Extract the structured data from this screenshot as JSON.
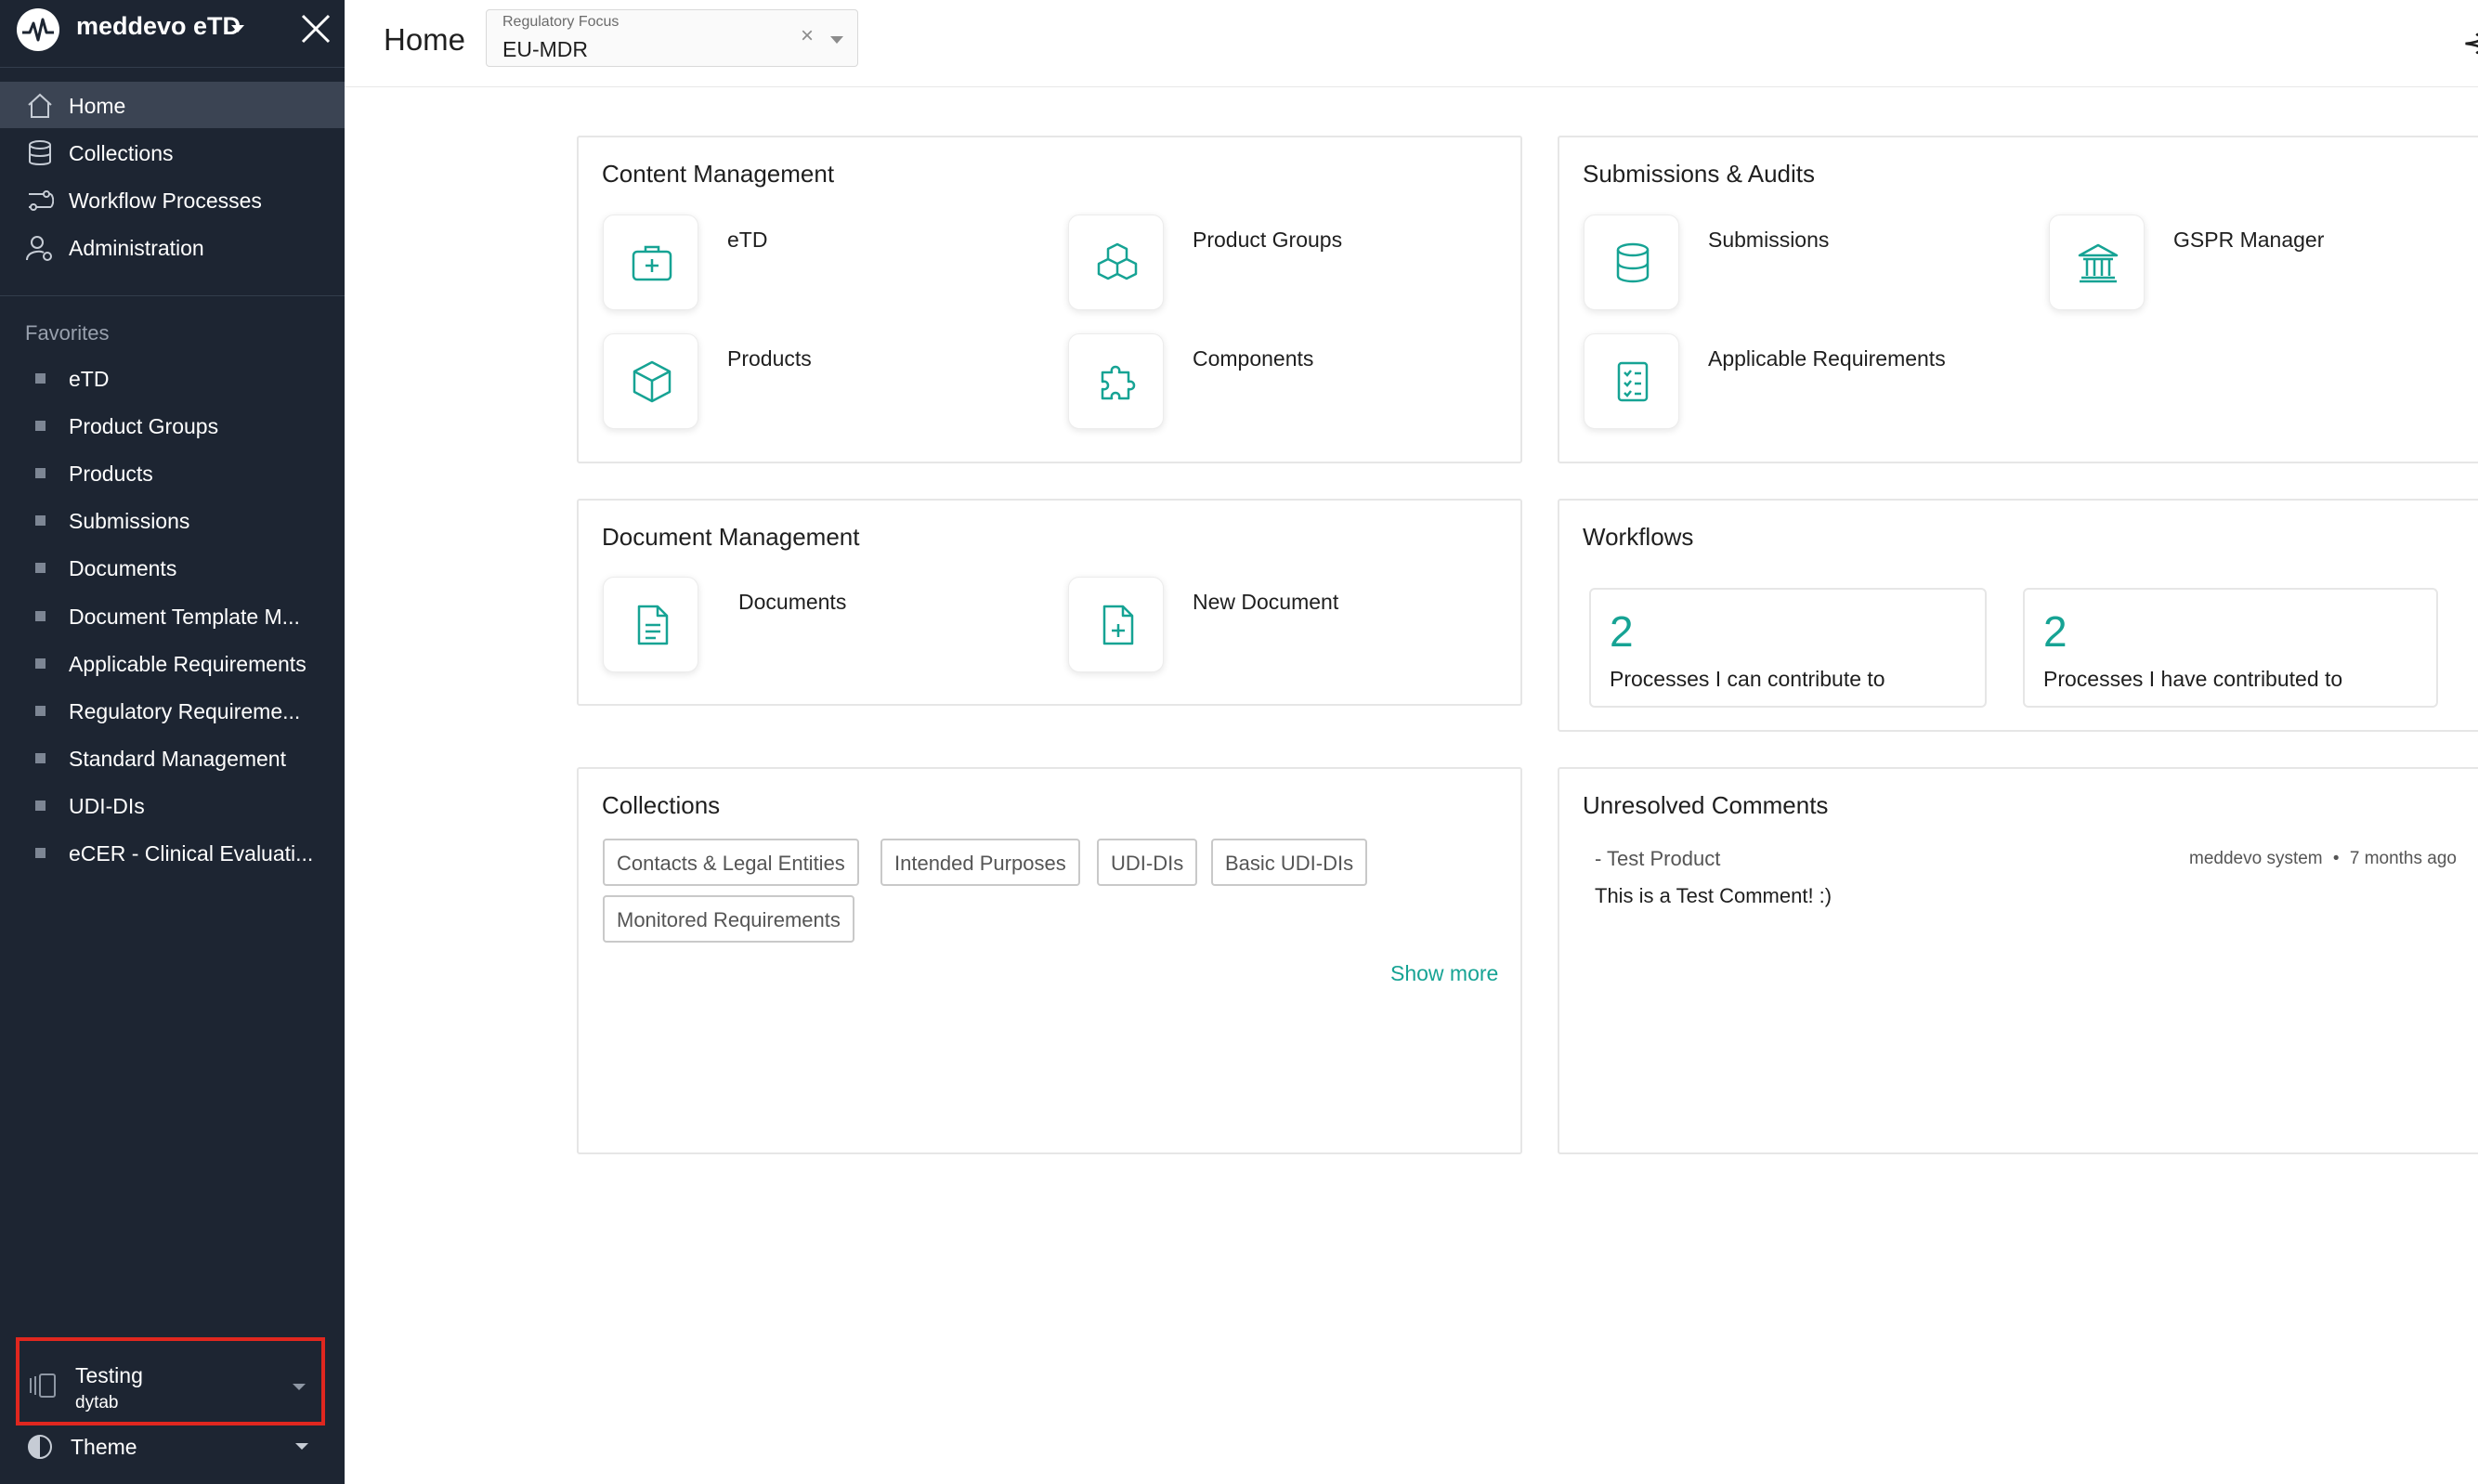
{
  "sidebar": {
    "brand": "meddevo eTD",
    "nav": [
      {
        "label": "Home",
        "icon": "home-icon",
        "active": true
      },
      {
        "label": "Collections",
        "icon": "database-icon"
      },
      {
        "label": "Workflow Processes",
        "icon": "workflow-icon"
      },
      {
        "label": "Administration",
        "icon": "user-settings-icon"
      }
    ],
    "favorites_title": "Favorites",
    "favorites": [
      "eTD",
      "Product Groups",
      "Products",
      "Submissions",
      "Documents",
      "Document Template M...",
      "Applicable Requirements",
      "Regulatory Requireme...",
      "Standard Management",
      "UDI-DIs",
      "eCER - Clinical Evaluati..."
    ],
    "workspace": {
      "name": "Testing",
      "sub": "dytab"
    },
    "theme_label": "Theme"
  },
  "header": {
    "title": "Home",
    "regulatory_focus": {
      "label": "Regulatory Focus",
      "value": "EU-MDR",
      "clear": "×"
    },
    "cut_glyph": "⊰"
  },
  "content_management": {
    "title": "Content Management",
    "tiles": [
      {
        "label": "eTD",
        "icon": "medical-kit-icon"
      },
      {
        "label": "Product Groups",
        "icon": "cubes-icon"
      },
      {
        "label": "Products",
        "icon": "box-icon"
      },
      {
        "label": "Components",
        "icon": "puzzle-icon"
      }
    ]
  },
  "submissions_audits": {
    "title": "Submissions & Audits",
    "tiles": [
      {
        "label": "Submissions",
        "icon": "database-icon"
      },
      {
        "label": "GSPR Manager",
        "icon": "bank-icon"
      },
      {
        "label": "Applicable Requirements",
        "icon": "checklist-icon"
      }
    ]
  },
  "document_management": {
    "title": "Document Management",
    "tiles": [
      {
        "label": "Documents",
        "icon": "document-icon"
      },
      {
        "label": "New Document",
        "icon": "document-add-icon"
      }
    ]
  },
  "workflows": {
    "title": "Workflows",
    "stats": [
      {
        "value": "2",
        "label": "Processes I can contribute to"
      },
      {
        "value": "2",
        "label": "Processes I have contributed to"
      }
    ]
  },
  "collections": {
    "title": "Collections",
    "chips": [
      "Contacts & Legal Entities",
      "Intended Purposes",
      "UDI-DIs",
      "Basic UDI-DIs",
      "Monitored Requirements"
    ],
    "show_more": "Show more"
  },
  "comments": {
    "title": "Unresolved Comments",
    "items": [
      {
        "subject": "- Test Product",
        "author": "meddevo system",
        "separator": "•",
        "time": "7 months ago",
        "body": "This is a Test Comment! :)"
      }
    ]
  },
  "colors": {
    "accent": "#16a394",
    "sidebar_bg": "#1d2532",
    "highlight": "#e0271f"
  }
}
